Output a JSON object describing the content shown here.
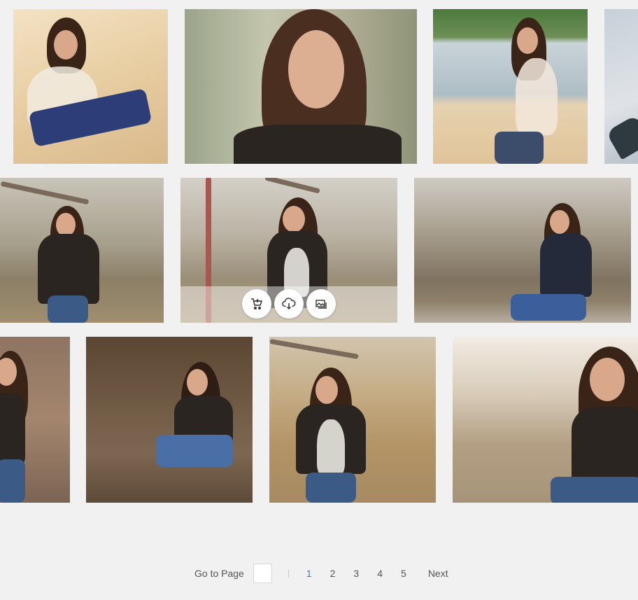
{
  "gallery": {
    "photos": [
      {
        "alt": "photo-1"
      },
      {
        "alt": "photo-2"
      },
      {
        "alt": "photo-3"
      },
      {
        "alt": "photo-4"
      },
      {
        "alt": "photo-5"
      },
      {
        "alt": "photo-6"
      },
      {
        "alt": "photo-7"
      },
      {
        "alt": "photo-8"
      },
      {
        "alt": "photo-9"
      },
      {
        "alt": "photo-10"
      },
      {
        "alt": "photo-11"
      },
      {
        "alt": "photo-12"
      }
    ],
    "hover_actions": {
      "add_to_cart_icon": "cart-plus-icon",
      "download_icon": "cloud-download-icon",
      "similar_icon": "similar-images-icon"
    }
  },
  "pagination": {
    "goto_label": "Go to Page",
    "goto_value": "",
    "pages": [
      "1",
      "2",
      "3",
      "4",
      "5"
    ],
    "current_page": "1",
    "next_label": "Next"
  },
  "colors": {
    "background": "#f1f1f1",
    "current_page": "#2e7fd6",
    "text": "#555555"
  }
}
